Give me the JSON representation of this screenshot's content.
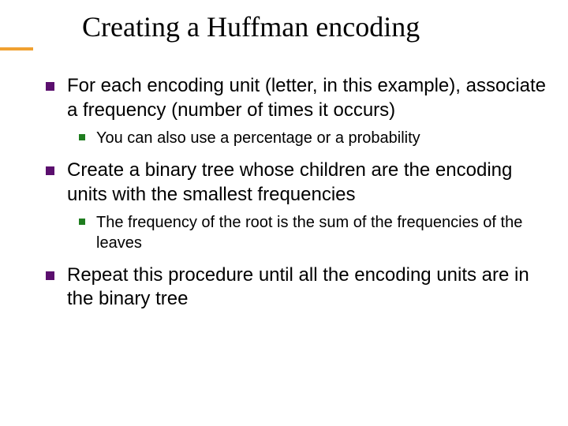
{
  "title": "Creating a Huffman encoding",
  "bullets": [
    {
      "text": "For each encoding unit (letter, in this example), associate a frequency (number of times it occurs)",
      "sub": [
        {
          "text": "You can also use a percentage or a probability"
        }
      ]
    },
    {
      "text": "Create a binary tree whose children are the encoding units with the smallest frequencies",
      "sub": [
        {
          "text": "The frequency of the root is the sum of the frequencies of the leaves"
        }
      ]
    },
    {
      "text": "Repeat this procedure until all the encoding units are in the binary tree",
      "sub": []
    }
  ]
}
